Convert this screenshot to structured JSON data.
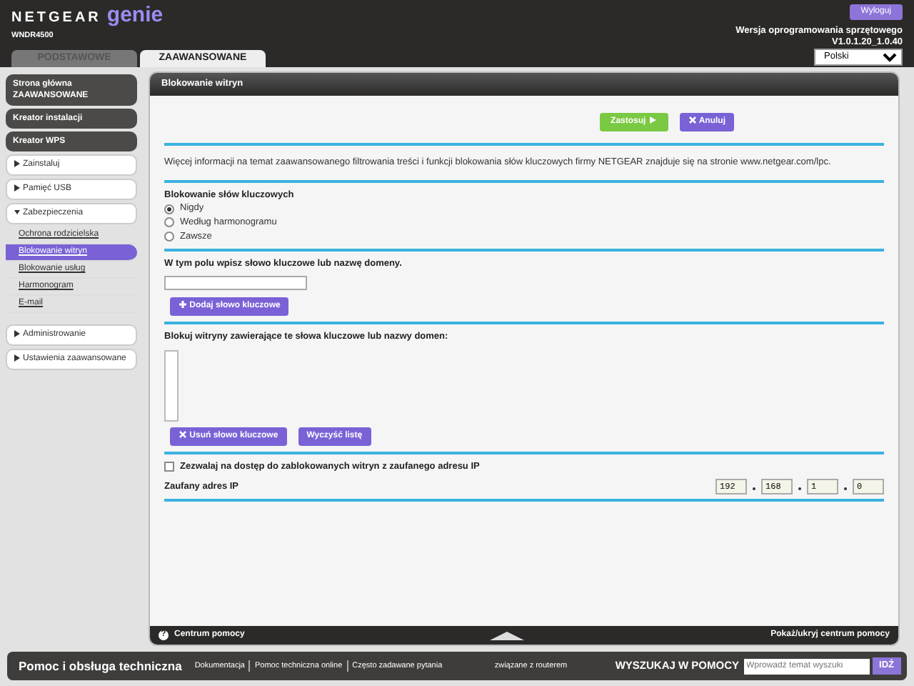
{
  "header": {
    "logo_brand": "NETGEAR",
    "logo_product": "genie",
    "model": "WNDR4500",
    "logout": "Wyloguj",
    "firmware_label": "Wersja oprogramowania sprzętowego",
    "firmware_version": "V1.0.1.20_1.0.40",
    "language": "Polski"
  },
  "tabs": [
    {
      "label": "PODSTAWOWE",
      "selected": false
    },
    {
      "label": "ZAAWANSOWANE",
      "selected": true
    }
  ],
  "sidebar": {
    "items": [
      {
        "kind": "link",
        "label": "Strona główna ZAAWANSOWANE"
      },
      {
        "kind": "link",
        "label": "Kreator instalacji"
      },
      {
        "kind": "link",
        "label": "Kreator WPS"
      },
      {
        "kind": "section",
        "label": "Zainstaluj",
        "expanded": false
      },
      {
        "kind": "section",
        "label": "Pamięć USB",
        "expanded": false
      },
      {
        "kind": "section",
        "label": "Zabezpieczenia",
        "expanded": true,
        "children": [
          {
            "label": "Ochrona rodzicielska",
            "selected": false
          },
          {
            "label": "Blokowanie witryn",
            "selected": true
          },
          {
            "label": "Blokowanie usług",
            "selected": false
          },
          {
            "label": "Harmonogram",
            "selected": false
          },
          {
            "label": "E-mail",
            "selected": false
          }
        ]
      },
      {
        "kind": "section",
        "label": "Administrowanie",
        "expanded": false
      },
      {
        "kind": "section",
        "label": "Ustawienia zaawansowane",
        "expanded": false
      }
    ]
  },
  "panel": {
    "title": "Blokowanie witryn",
    "apply": "Zastosuj",
    "cancel": "Anuluj",
    "info": "Więcej informacji na temat zaawansowanego filtrowania treści i funkcji blokowania słów kluczowych firmy NETGEAR znajduje się na stronie www.netgear.com/lpc.",
    "keyword_blocking": {
      "title": "Blokowanie słów kluczowych",
      "options": [
        {
          "label": "Nigdy",
          "selected": true
        },
        {
          "label": "Według harmonogramu",
          "selected": false
        },
        {
          "label": "Zawsze",
          "selected": false
        }
      ]
    },
    "keyword_label": "W tym polu wpisz słowo kluczowe lub nazwę domeny.",
    "add_button": "Dodaj słowo kluczowe",
    "list_label": "Blokuj witryny zawierające te słowa kluczowe lub nazwy domen:",
    "remove_button": "Usuń słowo kluczowe",
    "clear_button": "Wyczyść listę",
    "trusted_checkbox": {
      "label": "Zezwalaj na dostęp do zablokowanych witryn z zaufanego adresu IP",
      "checked": false
    },
    "trusted_ip_label": "Zaufany adres IP",
    "trusted_ip": [
      "192",
      "168",
      "1",
      "0"
    ],
    "help_icon": "?",
    "help_center": "Centrum pomocy",
    "help_toggle": "Pokaż/ukryj centrum pomocy"
  },
  "footer": {
    "title": "Pomoc i obsługa techniczna",
    "links": [
      "Dokumentacja",
      "Pomoc techniczna online",
      "Często zadawane pytania"
    ],
    "note": "związane z routerem",
    "search_label": "WYSZUKAJ W POMOCY",
    "search_placeholder": "Wprowadź temat wyszuki",
    "search_button": "IDŹ"
  }
}
